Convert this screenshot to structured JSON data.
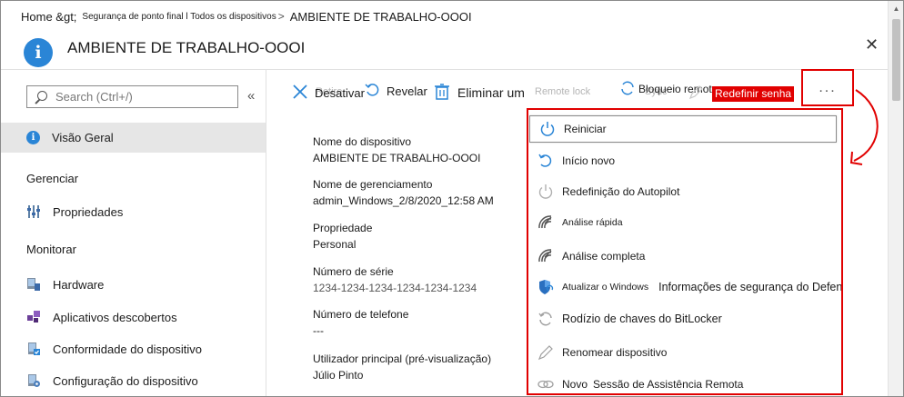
{
  "breadcrumb": {
    "home": "Home &gt;",
    "middle": "Segurança de ponto final l Todos os dispositivos",
    "current": "AMBIENTE DE TRABALHO-OOOI"
  },
  "header": {
    "title": "AMBIENTE DE TRABALHO-OOOI",
    "close_icon": "close-icon"
  },
  "sidebar": {
    "search_placeholder": "Search (Ctrl+/)",
    "collapse_glyph": "«",
    "overview": "Visão Geral",
    "section_manage": "Gerenciar",
    "properties": "Propriedades",
    "section_monitor": "Monitorar",
    "items": [
      {
        "label": "Hardware",
        "icon": "hardware-icon"
      },
      {
        "label": "Aplicativos descobertos",
        "icon": "apps-icon"
      },
      {
        "label": "Conformidade do dispositivo",
        "icon": "compliance-icon"
      },
      {
        "label": "Configuração do dispositivo",
        "icon": "configuration-icon"
      }
    ]
  },
  "toolbar": {
    "retire_ghost": "Retire",
    "deactivate": "Desativar",
    "reveal": "Revelar",
    "delete": "Eliminar um",
    "remote_lock_ghost": "Remote lock",
    "sync_ghost": "Sync",
    "remote_lock_pt": "Bloqueio remoto",
    "reset_password_tag": "Redefinir senha",
    "more": "..."
  },
  "details": [
    {
      "label": "Nome do dispositivo",
      "value": "AMBIENTE DE TRABALHO-OOOI"
    },
    {
      "label": "Nome de gerenciamento",
      "value": "admin_Windows_2/8/2020_12:58 AM"
    },
    {
      "label": "Propriedade",
      "value": "Personal"
    },
    {
      "label": "Número de série",
      "value": "1234-1234-1234-1234-1234-1234"
    },
    {
      "label": "Número de telefone",
      "value": "---"
    },
    {
      "label": "Utilizador principal (pré-visualização)",
      "value": "Júlio Pinto"
    }
  ],
  "menu": {
    "restart": "Reiniciar",
    "fresh_start": "Início novo",
    "autopilot_reset": "Redefinição do Autopilot",
    "quick_scan": "Análise rápida",
    "full_scan": "Análise completa",
    "update_windows": "Atualizar o Windows",
    "defender_info": "Informações de segurança do Defender",
    "bitlocker": "Rodízio de chaves do BitLocker",
    "rename": "Renomear dispositivo",
    "new": "Novo",
    "remote_assist": "Sessão de Assistência Remota"
  },
  "colors": {
    "accent": "#2a85d6",
    "highlight_red": "#e10000",
    "selected_nav": "#e6e6e6"
  }
}
